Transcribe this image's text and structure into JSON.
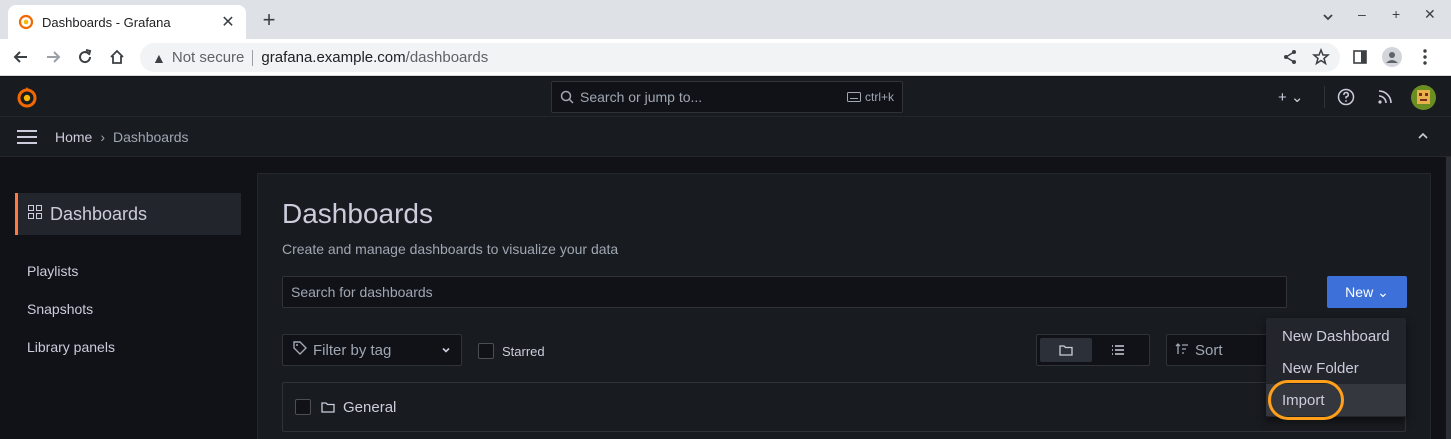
{
  "browser": {
    "tab_title": "Dashboards - Grafana",
    "close_glyph": "✕",
    "newtab_glyph": "+",
    "not_secure": "Not secure",
    "url_host": "grafana.example.com",
    "url_path": "/dashboards"
  },
  "topnav": {
    "search_placeholder": "Search or jump to...",
    "search_shortcut": "ctrl+k",
    "plus_label": "+ ⌄"
  },
  "breadcrumb": {
    "home": "Home",
    "separator": "›",
    "current": "Dashboards"
  },
  "sidebar": {
    "active": "Dashboards",
    "items": [
      {
        "label": "Playlists"
      },
      {
        "label": "Snapshots"
      },
      {
        "label": "Library panels"
      }
    ]
  },
  "main": {
    "title": "Dashboards",
    "subtitle": "Create and manage dashboards to visualize your data",
    "search_placeholder": "Search for dashboards",
    "new_button": "New ⌄",
    "filter_tag": "Filter by tag",
    "starred": "Starred",
    "sort": "Sort",
    "folder_row": "General"
  },
  "dropdown": {
    "items": [
      "New Dashboard",
      "New Folder",
      "Import"
    ]
  },
  "colors": {
    "accent": "#ff7941",
    "primary_button": "#3d71d9",
    "highlight_ring": "#ff9f1a"
  }
}
